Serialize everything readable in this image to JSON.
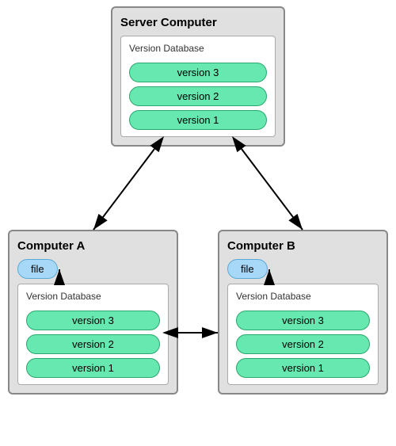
{
  "server": {
    "title": "Server Computer",
    "db_label": "Version Database",
    "versions": [
      "version 3",
      "version 2",
      "version 1"
    ]
  },
  "computer_a": {
    "title": "Computer A",
    "file_label": "file",
    "db_label": "Version Database",
    "versions": [
      "version 3",
      "version 2",
      "version 1"
    ]
  },
  "computer_b": {
    "title": "Computer B",
    "file_label": "file",
    "db_label": "Version Database",
    "versions": [
      "version 3",
      "version 2",
      "version 1"
    ]
  }
}
